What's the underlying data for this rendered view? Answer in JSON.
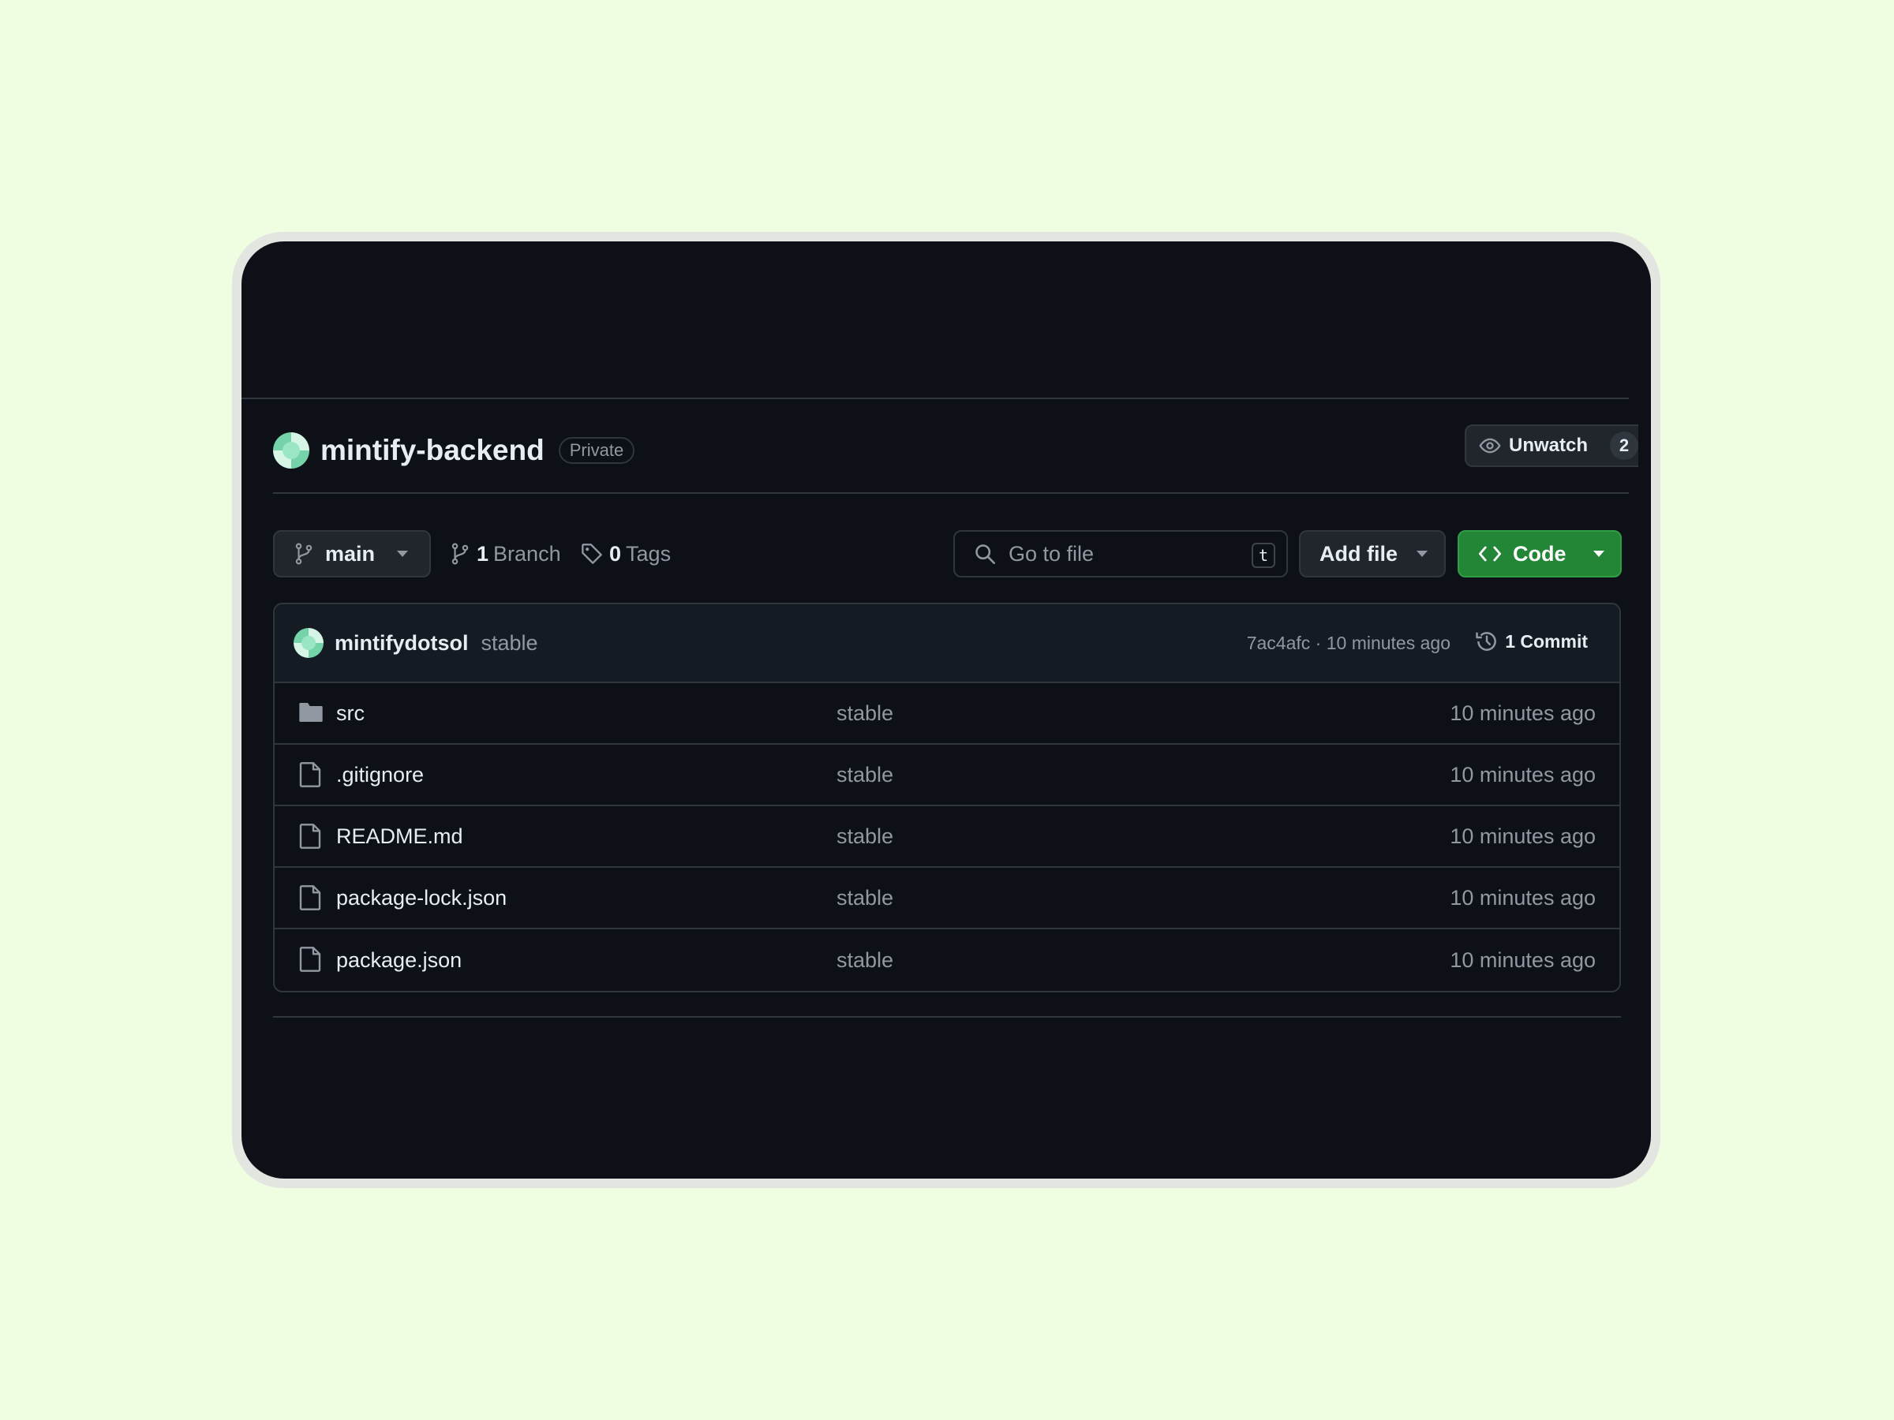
{
  "repo": {
    "name": "mintify-backend",
    "visibility": "Private",
    "watch_label": "Unwatch",
    "watch_count": "2"
  },
  "toolbar": {
    "branch": "main",
    "branch_count": "1",
    "branch_label": "Branch",
    "tag_count": "0",
    "tag_label": "Tags",
    "search_placeholder": "Go to file",
    "search_shortcut": "t",
    "add_file_label": "Add file",
    "code_label": "Code"
  },
  "latest_commit": {
    "author": "mintifydotsol",
    "message": "stable",
    "meta": "7ac4afc · 10 minutes ago",
    "commit_count_label": "1 Commit"
  },
  "files": [
    {
      "name": "src",
      "type": "folder",
      "message": "stable",
      "time": "10 minutes ago"
    },
    {
      "name": ".gitignore",
      "type": "file",
      "message": "stable",
      "time": "10 minutes ago"
    },
    {
      "name": "README.md",
      "type": "file",
      "message": "stable",
      "time": "10 minutes ago"
    },
    {
      "name": "package-lock.json",
      "type": "file",
      "message": "stable",
      "time": "10 minutes ago"
    },
    {
      "name": "package.json",
      "type": "file",
      "message": "stable",
      "time": "10 minutes ago"
    }
  ],
  "colors": {
    "page_bg": "#effde0",
    "window_bg": "#0d1117",
    "border": "#30363d",
    "code_button": "#238636",
    "muted_text": "#9198a1"
  },
  "icons": [
    "repo-avatar",
    "eye-icon",
    "branch-icon",
    "tag-icon",
    "search-icon",
    "code-icon",
    "history-icon",
    "folder-icon",
    "file-icon",
    "chevron-down-icon"
  ]
}
